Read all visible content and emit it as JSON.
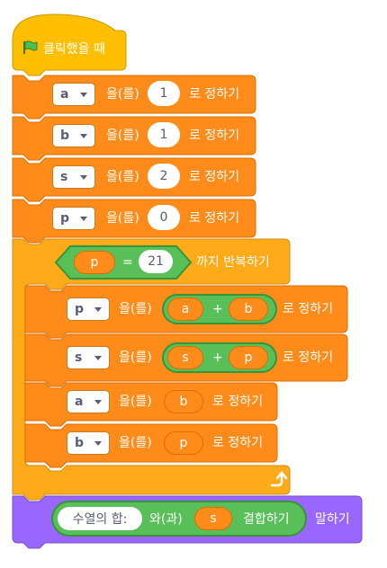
{
  "hat": {
    "label": "클릭했을 때",
    "icon": "green-flag-icon"
  },
  "set_blocks": [
    {
      "var": "a",
      "particle": "을(를)",
      "value": "1",
      "suffix": "로 정하기"
    },
    {
      "var": "b",
      "particle": "을(를)",
      "value": "1",
      "suffix": "로 정하기"
    },
    {
      "var": "s",
      "particle": "을(를)",
      "value": "2",
      "suffix": "로 정하기"
    },
    {
      "var": "p",
      "particle": "을(를)",
      "value": "0",
      "suffix": "로 정하기"
    }
  ],
  "repeat": {
    "cond_left": "p",
    "cond_op": "=",
    "cond_right": "21",
    "label": "까지 반복하기",
    "body": [
      {
        "var": "p",
        "particle": "을(를)",
        "left": "a",
        "op": "+",
        "right": "b",
        "suffix": "로 정하기"
      },
      {
        "var": "s",
        "particle": "을(를)",
        "left": "s",
        "op": "+",
        "right": "p",
        "suffix": "로 정하기"
      },
      {
        "var": "a",
        "particle": "을(를)",
        "value": "b",
        "suffix": "로 정하기"
      },
      {
        "var": "b",
        "particle": "을(를)",
        "value": "p",
        "suffix": "로 정하기"
      }
    ],
    "loop_icon": "loop-arrow-icon"
  },
  "say": {
    "text": "수열의 합:",
    "join": "와(과)",
    "var": "s",
    "join_label": "결합하기",
    "label": "말하기"
  },
  "colors": {
    "orange": "#ff8c1a",
    "orange_dark": "#db6e00",
    "control": "#ffab19",
    "looks": "#9966ff",
    "green": "#59c059"
  }
}
